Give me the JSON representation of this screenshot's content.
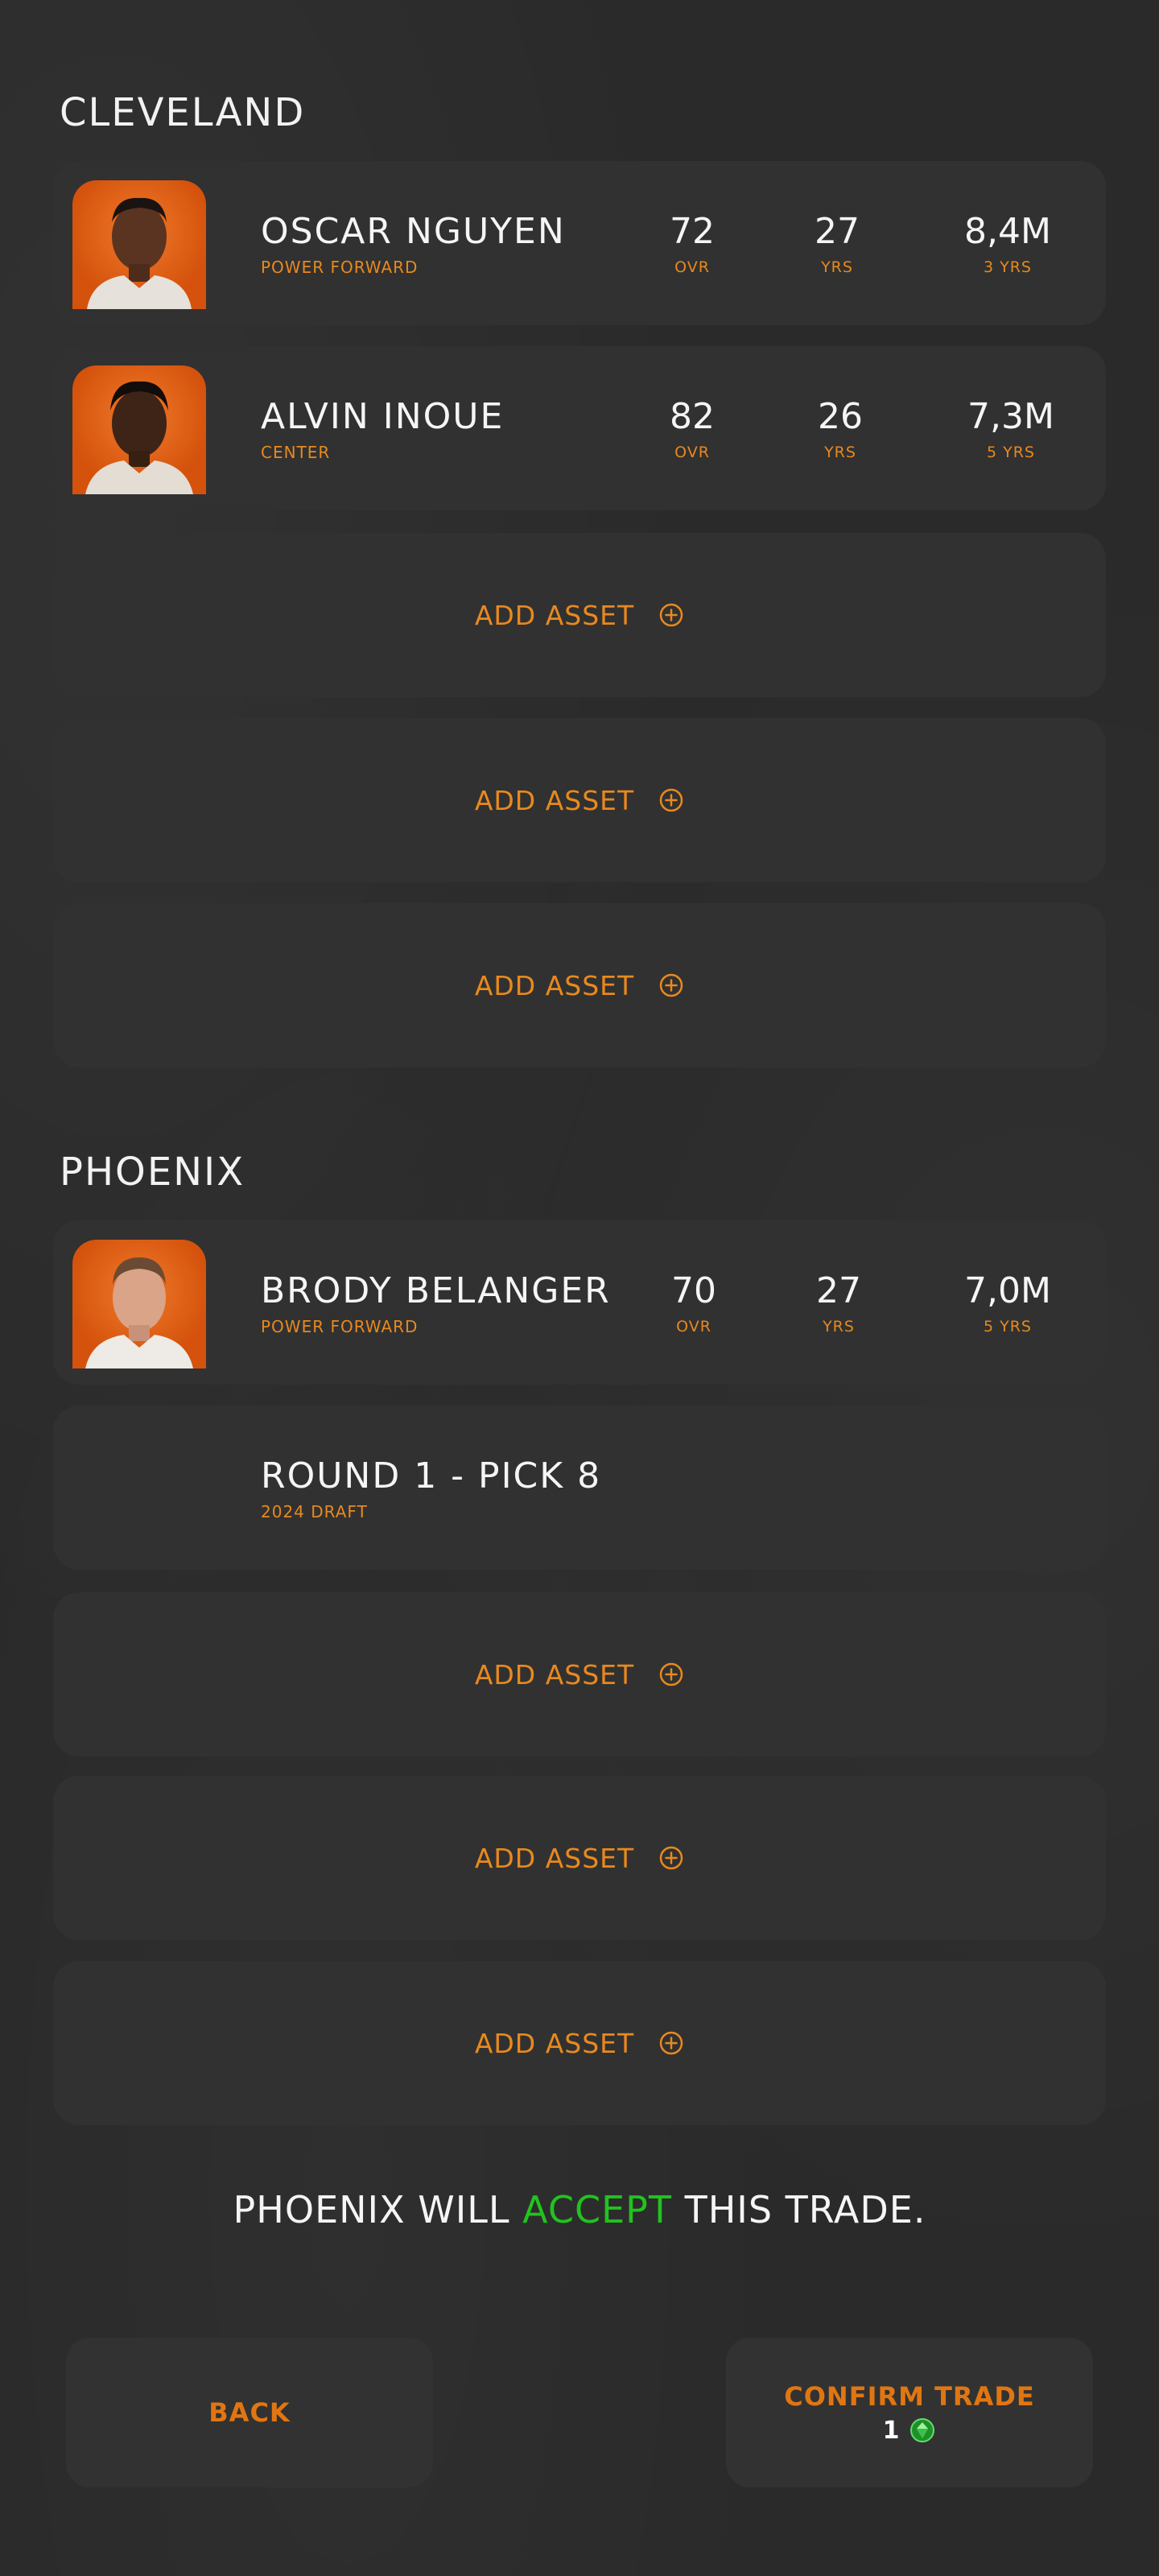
{
  "teams": [
    {
      "name": "CLEVELAND",
      "players": [
        {
          "name": "OSCAR NGUYEN",
          "position": "POWER FORWARD",
          "ovr": "72",
          "ovr_label": "OVR",
          "age": "27",
          "age_label": "YRS",
          "salary": "8,4M",
          "contract": "3 YRS"
        },
        {
          "name": "ALVIN INOUE",
          "position": "CENTER",
          "ovr": "82",
          "ovr_label": "OVR",
          "age": "26",
          "age_label": "YRS",
          "salary": "7,3M",
          "contract": "5 YRS"
        }
      ],
      "add_slots": [
        "ADD ASSET",
        "ADD ASSET",
        "ADD ASSET"
      ]
    },
    {
      "name": "PHOENIX",
      "players": [
        {
          "name": "BRODY BELANGER",
          "position": "POWER FORWARD",
          "ovr": "70",
          "ovr_label": "OVR",
          "age": "27",
          "age_label": "YRS",
          "salary": "7,0M",
          "contract": "5 YRS"
        }
      ],
      "picks": [
        {
          "name": "ROUND 1 - PICK 8",
          "subtitle": "2024 DRAFT"
        }
      ],
      "add_slots": [
        "ADD ASSET",
        "ADD ASSET",
        "ADD ASSET"
      ]
    }
  ],
  "verdict": {
    "before": "PHOENIX WILL ",
    "highlight": "ACCEPT",
    "after": " THIS TRADE."
  },
  "buttons": {
    "back": "BACK",
    "confirm": "CONFIRM TRADE",
    "confirm_cost": "1"
  },
  "icons": {
    "add": "plus-circle-icon",
    "currency": "green-gem-icon"
  },
  "colors": {
    "accent": "#e8891e",
    "accept": "#22c21f",
    "card": "#313131",
    "background": "#2a2a2a"
  }
}
